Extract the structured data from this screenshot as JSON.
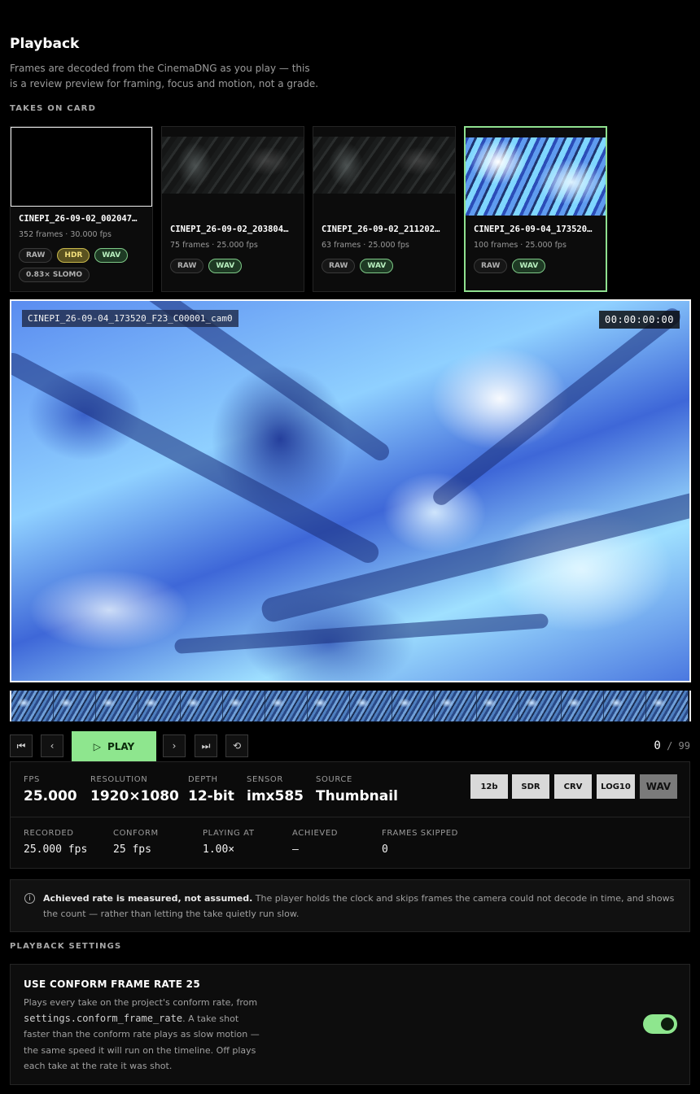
{
  "page": {
    "title": "Playback",
    "subtitle": "Frames are decoded from the CinemaDNG as you play — this is a review preview for framing, focus and motion, not a grade."
  },
  "takes_section": {
    "label": "TAKES ON CARD",
    "takes": [
      {
        "name": "CINEPI_26-09-02_002047…",
        "meta": "352 frames · 30.000 fps",
        "badges": [
          "RAW",
          "HDR",
          "WAV",
          "0.83× SLOMO"
        ]
      },
      {
        "name": "CINEPI_26-09-02_203804…",
        "meta": "75 frames · 25.000 fps",
        "badges": [
          "RAW",
          "WAV"
        ]
      },
      {
        "name": "CINEPI_26-09-02_211202…",
        "meta": "63 frames · 25.000 fps",
        "badges": [
          "RAW",
          "WAV"
        ]
      },
      {
        "name": "CINEPI_26-09-04_173520…",
        "meta": "100 frames · 25.000 fps",
        "badges": [
          "RAW",
          "WAV"
        ]
      }
    ]
  },
  "viewer": {
    "clip_name": "CINEPI_26-09-04_173520_F23_C00001_cam0",
    "timecode": "00:00:00:00"
  },
  "controls": {
    "first_icon": "skip-to-start-icon",
    "prev_icon": "chevron-left-icon",
    "play_label": "PLAY",
    "next_icon": "chevron-right-icon",
    "last_icon": "skip-to-end-icon",
    "loop_icon": "loop-icon",
    "current_frame": "0",
    "separator": "/",
    "total_frames": "99"
  },
  "stats": {
    "fps_label": "FPS",
    "fps_value": "25.000",
    "resolution_label": "RESOLUTION",
    "resolution_value": "1920×1080",
    "depth_label": "DEPTH",
    "depth_value": "12-bit",
    "sensor_label": "SENSOR",
    "sensor_value": "imx585",
    "source_label": "SOURCE",
    "source_value": "Thumbnail",
    "format_buttons": [
      "12b",
      "SDR",
      "CRV",
      "LOG10",
      "WAV"
    ],
    "recorded_label": "RECORDED",
    "recorded_value": "25.000 fps",
    "conform_label": "CONFORM",
    "conform_value": "25 fps",
    "playing_label": "PLAYING AT",
    "playing_value": "1.00×",
    "achieved_label": "ACHIEVED",
    "achieved_value": "—",
    "skipped_label": "FRAMES SKIPPED",
    "skipped_value": "0"
  },
  "info": {
    "bold": "Achieved rate is measured, not assumed.",
    "text": " The player holds the clock and skips frames the camera could not decode in time, and shows the count — rather than letting the take quietly run slow."
  },
  "settings_section": {
    "label": "PLAYBACK SETTINGS",
    "conform_title": "USE CONFORM FRAME RATE 25",
    "desc_1": "Plays every take on the project's conform rate, from ",
    "desc_code": "settings.conform_frame_rate",
    "desc_2": ". A take shot faster than the conform rate plays as slow motion — the same speed it will run on the timeline. Off plays each take at the rate it was shot.",
    "toggle_on": true
  },
  "colors": {
    "accent": "#8ee68e",
    "hdr": "#f3e07c",
    "wav": "#b8f0bf"
  }
}
